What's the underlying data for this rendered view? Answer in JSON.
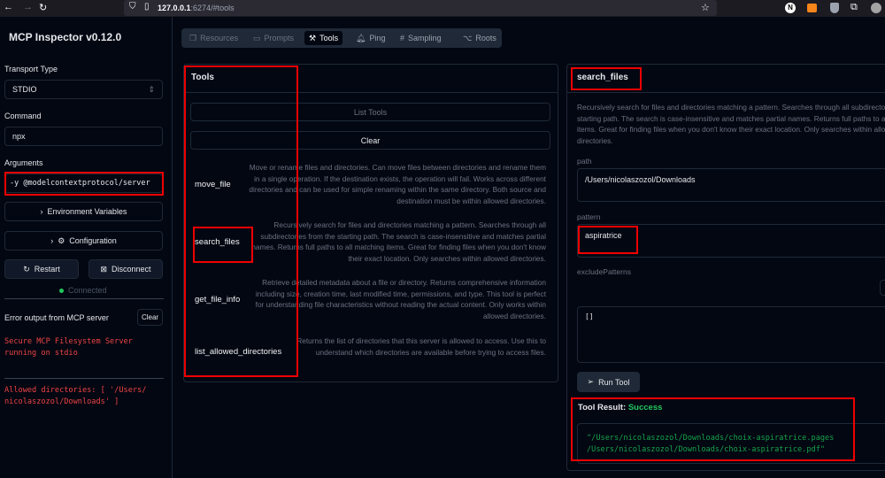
{
  "browser": {
    "url_host": "127.0.0.1",
    "url_rest": ":6274/#tools",
    "icons": [
      "back-icon",
      "forward-icon",
      "reload-icon",
      "shield-icon",
      "page-icon",
      "star-icon",
      "n-extension-icon",
      "metamask-fox-icon",
      "shield-extension-icon",
      "extensions-icon",
      "profile-icon"
    ]
  },
  "sidebar": {
    "title": "MCP Inspector v0.12.0",
    "transport_label": "Transport Type",
    "transport_value": "STDIO",
    "command_label": "Command",
    "command_value": "npx",
    "arguments_label": "Arguments",
    "arguments_value": "-y @modelcontextprotocol/server",
    "env_button": "Environment Variables",
    "config_button": "Configuration",
    "restart_button": "Restart",
    "disconnect_button": "Disconnect",
    "status": "Connected",
    "status_color": "#22c55e",
    "error_title": "Error output from MCP server",
    "clear_button": "Clear",
    "errors": [
      "Secure MCP Filesystem Server running on stdio",
      "Allowed directories: [ '/Users/ nicolaszozol/Downloads' ]"
    ]
  },
  "tabs": [
    {
      "label": "Resources"
    },
    {
      "label": "Prompts"
    },
    {
      "label": "Tools"
    },
    {
      "label": "Ping"
    },
    {
      "label": "Sampling"
    },
    {
      "label": "Roots"
    }
  ],
  "tools": {
    "title": "Tools",
    "list_button": "List Tools",
    "clear_button": "Clear",
    "items": [
      {
        "name": "move_file",
        "description": "Move or rename files and directories. Can move files between directories and rename them in a single operation. If the destination exists, the operation will fail. Works across different directories and can be used for simple renaming within the same directory. Both source and destination must be within allowed directories."
      },
      {
        "name": "search_files",
        "description": "Recursively search for files and directories matching a pattern. Searches through all subdirectories from the starting path. The search is case-insensitive and matches partial names. Returns full paths to all matching items. Great for finding files when you don't know their exact location. Only searches within allowed directories."
      },
      {
        "name": "get_file_info",
        "description": "Retrieve detailed metadata about a file or directory. Returns comprehensive information including size, creation time, last modified time, permissions, and type. This tool is perfect for understanding file characteristics without reading the actual content. Only works within allowed directories."
      },
      {
        "name": "list_allowed_directories",
        "description": "Returns the list of directories that this server is allowed to access. Use this to understand which directories are available before trying to access files."
      }
    ]
  },
  "detail": {
    "title": "search_files",
    "description": "Recursively search for files and directories matching a pattern. Searches through all subdirectories from the starting path. The search is case-insensitive and matches partial names. Returns full paths to all matching items. Great for finding files when you don't know their exact location. Only searches within allowed directories.",
    "path_label": "path",
    "path_value": "/Users/nicolaszozol/Downloads",
    "pattern_label": "pattern",
    "pattern_value": "aspiratrice",
    "exclude_label": "excludePatterns",
    "exclude_value": "[]",
    "run_button": "Run Tool",
    "result_label": "Tool Result:",
    "result_status": "Success",
    "result_lines": [
      "\"/Users/nicolaszozol/Downloads/choix-aspiratrice.pages",
      "/Users/nicolaszozol/Downloads/choix-aspiratrice.pdf\""
    ]
  }
}
